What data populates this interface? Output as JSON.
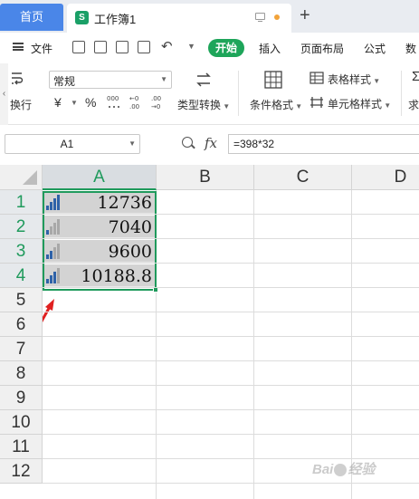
{
  "tabs": {
    "home_label": "首页",
    "doc_badge": "S",
    "doc_title": "工作簿1",
    "new_tab_icon": "plus-icon"
  },
  "menu": {
    "file_label": "文件",
    "start_label": "开始",
    "items": [
      "插入",
      "页面布局",
      "公式",
      "数"
    ]
  },
  "ribbon": {
    "wrap_label": "换行",
    "number_format": "常规",
    "currency_symbol": "¥",
    "percent_symbol": "%",
    "type_convert_label": "类型转换",
    "conditional_format_label": "条件格式",
    "table_style_label": "表格样式",
    "cell_style_label": "单元格样式",
    "sum_label": "求"
  },
  "formula_bar": {
    "name_box": "A1",
    "fx_label": "fx",
    "formula": "=398*32"
  },
  "grid": {
    "columns": [
      "A",
      "B",
      "C",
      "D"
    ],
    "rows": [
      "1",
      "2",
      "3",
      "4",
      "5",
      "6",
      "7",
      "8",
      "9",
      "10",
      "11",
      "12"
    ],
    "cells": [
      {
        "value": "12736",
        "bars_filled": 4
      },
      {
        "value": "7040",
        "bars_filled": 1
      },
      {
        "value": "9600",
        "bars_filled": 2
      },
      {
        "value": "10188.8",
        "bars_filled": 3
      }
    ],
    "selected_column": "A",
    "icon_set_color": "#2e62a8",
    "selection_color": "#1f9a5c"
  },
  "watermark": {
    "text_a": "Bai",
    "text_b": "经验"
  }
}
